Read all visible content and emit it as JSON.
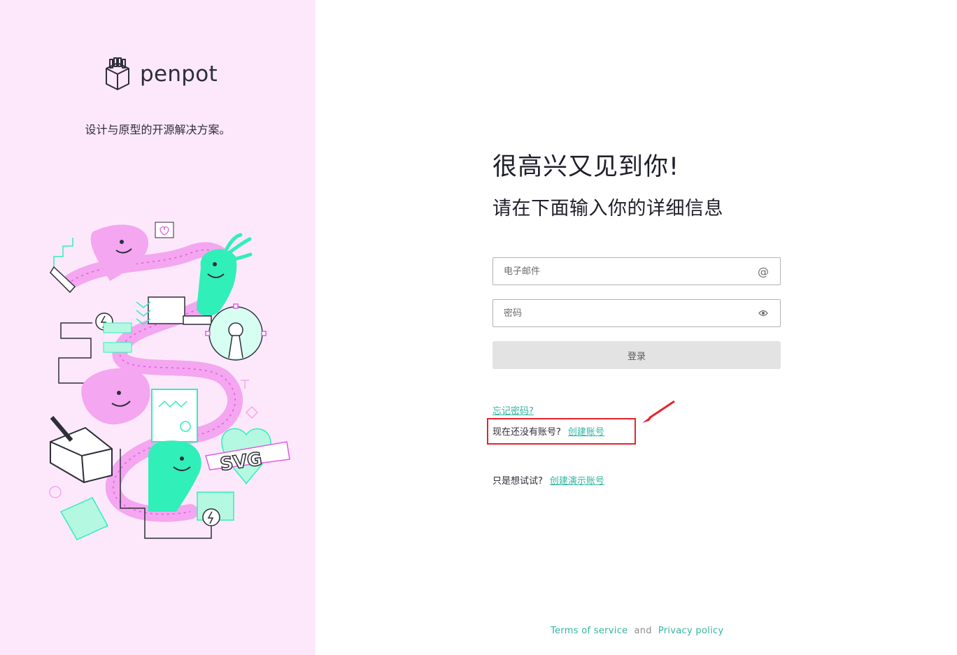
{
  "brand": {
    "name": "penpot",
    "tagline": "设计与原型的开源解决方案。"
  },
  "illustration": {
    "label": "SVG"
  },
  "main": {
    "title": "很高兴又见到你!",
    "subtitle": "请在下面输入你的详细信息",
    "email": {
      "placeholder": "电子邮件",
      "icon": "at-icon"
    },
    "password": {
      "placeholder": "密码",
      "icon": "eye-icon"
    },
    "login_label": "登录",
    "forgot_label": "忘记密码?",
    "no_account_text": "现在还没有账号?",
    "create_account_label": "创建账号",
    "try_text": "只是想试试?",
    "create_demo_label": "创建演示账号"
  },
  "footer": {
    "terms": "Terms of service",
    "and": "and",
    "privacy": "Privacy policy"
  },
  "colors": {
    "left_bg": "#fde8fb",
    "accent": "#31b5a1",
    "highlight": "#e8232c",
    "pink": "#f4a6f0",
    "mint": "#31efb8"
  }
}
